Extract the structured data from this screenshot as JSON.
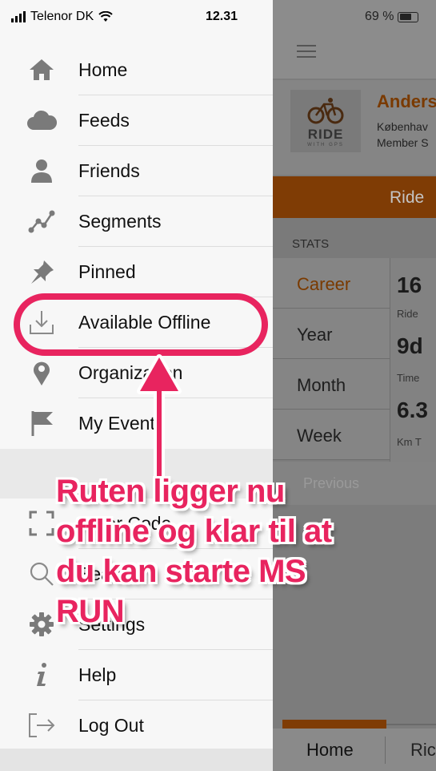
{
  "status_bar": {
    "carrier": "Telenor DK",
    "time": "12.31",
    "battery": "69 %"
  },
  "drawer": {
    "items_top": [
      {
        "label": "Home",
        "icon": "home-icon"
      },
      {
        "label": "Feeds",
        "icon": "cloud-icon"
      },
      {
        "label": "Friends",
        "icon": "person-icon"
      },
      {
        "label": "Segments",
        "icon": "segments-icon"
      },
      {
        "label": "Pinned",
        "icon": "pin-icon"
      },
      {
        "label": "Available Offline",
        "icon": "download-icon"
      },
      {
        "label": "Organization",
        "icon": "location-pin-icon"
      },
      {
        "label": "My Events",
        "icon": "flag-icon"
      }
    ],
    "items_bottom": [
      {
        "label": "Enter Code",
        "icon": "scan-code-icon"
      },
      {
        "label": "Search",
        "icon": "search-icon"
      },
      {
        "label": "Settings",
        "icon": "gear-icon"
      },
      {
        "label": "Help",
        "icon": "info-icon"
      },
      {
        "label": "Log Out",
        "icon": "logout-icon"
      }
    ]
  },
  "app": {
    "profile": {
      "logo_word": "RIDE",
      "logo_sub": "WITH GPS",
      "name": "Anders",
      "city": "Københav",
      "member": "Member S"
    },
    "ride_button": "Ride",
    "stats_label": "STATS",
    "stat_tabs": [
      "Career",
      "Year",
      "Month",
      "Week"
    ],
    "stat_values": {
      "rides_value": "16",
      "rides_label": "Ride",
      "time_value": "9d",
      "time_label": "Time",
      "km_value": "6.3",
      "km_label": "Km T"
    },
    "previous_label": "Previous",
    "tabbar": {
      "home": "Home",
      "routes": "Ric"
    }
  },
  "annotation": {
    "lines": [
      "Ruten ligger nu",
      "offline og klar til at",
      "du kan starte MS",
      "RUN"
    ],
    "color": "#e8245f"
  }
}
